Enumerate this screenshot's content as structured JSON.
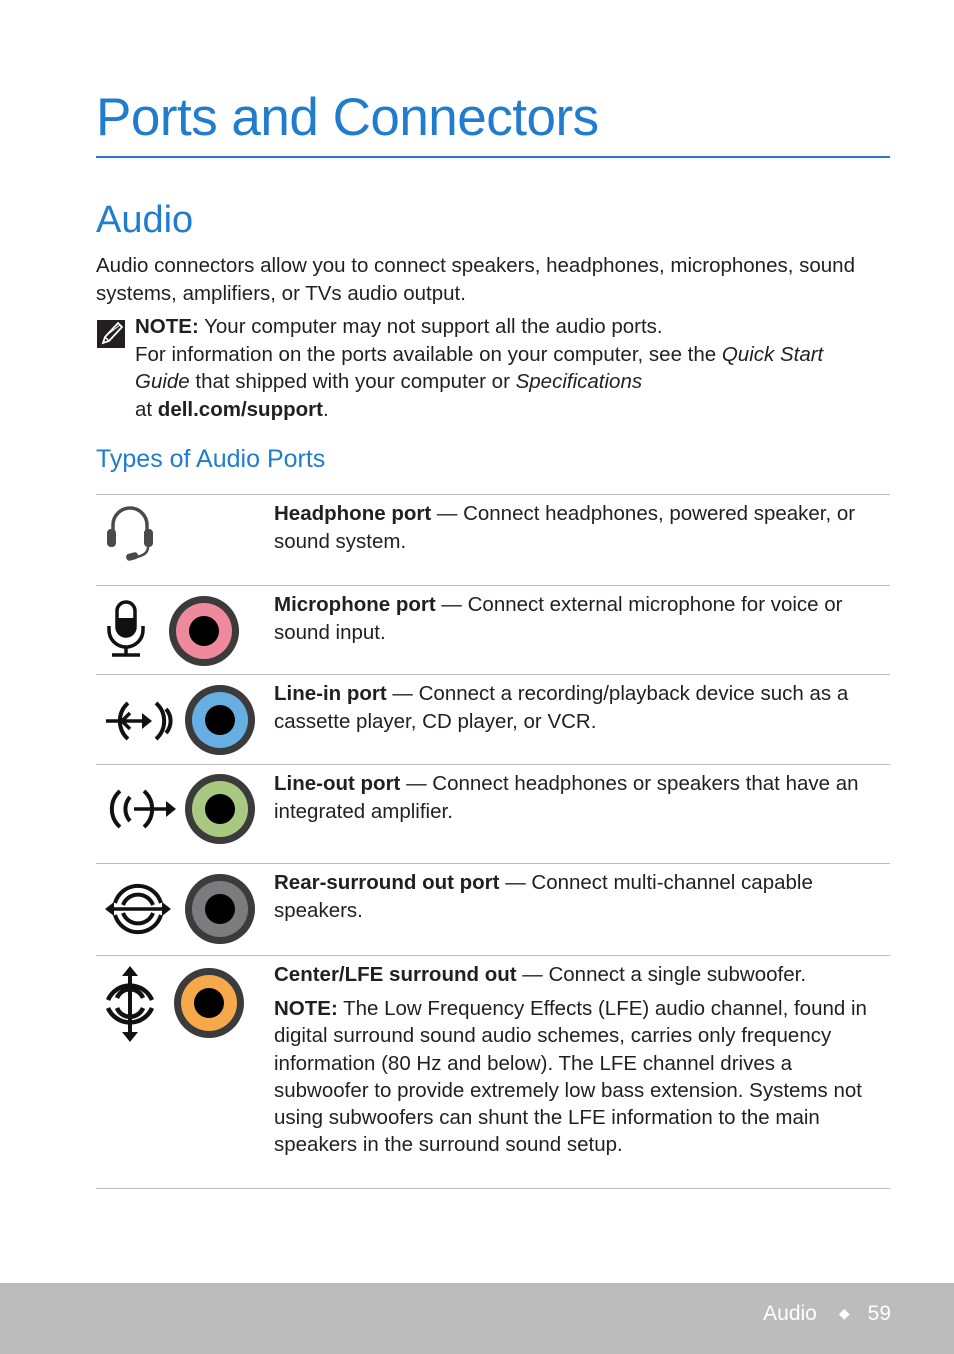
{
  "page": {
    "title": "Ports and Connectors",
    "section_title": "Audio",
    "intro": "Audio connectors allow you to connect speakers, headphones, microphones, sound systems, amplifiers, or TVs audio output.",
    "note": {
      "icon": "note-pencil-icon",
      "label": "NOTE:",
      "line1": " Your computer may not support all the audio ports.",
      "line2_prefix": "For information on the ports available on your computer, see the ",
      "guide_title": "Quick Start Guide",
      "line2_mid": " that shipped with your computer or ",
      "spec_title": "Specifications",
      "line2_at": " at ",
      "link": "dell.com/support",
      "end": "."
    },
    "subsection_title": "Types of Audio Ports"
  },
  "ports": [
    {
      "name": "Headphone port",
      "description": " — Connect headphones, powered speaker, or sound system.",
      "symbol_icon": "headset-icon",
      "jack_color": null
    },
    {
      "name": "Microphone port",
      "description": " — Connect external microphone for voice or sound input.",
      "symbol_icon": "microphone-icon",
      "jack_color": "#ee8a9c"
    },
    {
      "name": "Line-in port",
      "description": " — Connect a recording/playback device such as a cassette player, CD player, or VCR.",
      "symbol_icon": "line-in-icon",
      "jack_color": "#67aee3"
    },
    {
      "name": "Line-out port",
      "description": " — Connect headphones or speakers that have an integrated amplifier.",
      "symbol_icon": "line-out-icon",
      "jack_color": "#a9c982"
    },
    {
      "name": "Rear-surround out port",
      "description": " — Connect multi-channel capable speakers.",
      "symbol_icon": "rear-surround-icon",
      "jack_color": "#7c7c7e"
    },
    {
      "name": "Center/LFE surround out",
      "description": " — Connect a single subwoofer.",
      "symbol_icon": "center-lfe-icon",
      "jack_color": "#f5a94a",
      "note_label": "NOTE:",
      "note_text": " The Low Frequency Effects (LFE) audio channel, found in digital surround sound audio schemes, carries only frequency information (80 Hz and below). The LFE channel drives a subwoofer to provide extremely low bass extension. Systems not using subwoofers can shunt the LFE information to the main speakers in the surround sound setup."
    }
  ],
  "footer": {
    "section": "Audio",
    "separator": "◆",
    "page_number": "59"
  },
  "colors": {
    "accent": "#1f7ccf",
    "footer_bg": "#bcbcbc",
    "rule": "#bdbdbd"
  }
}
